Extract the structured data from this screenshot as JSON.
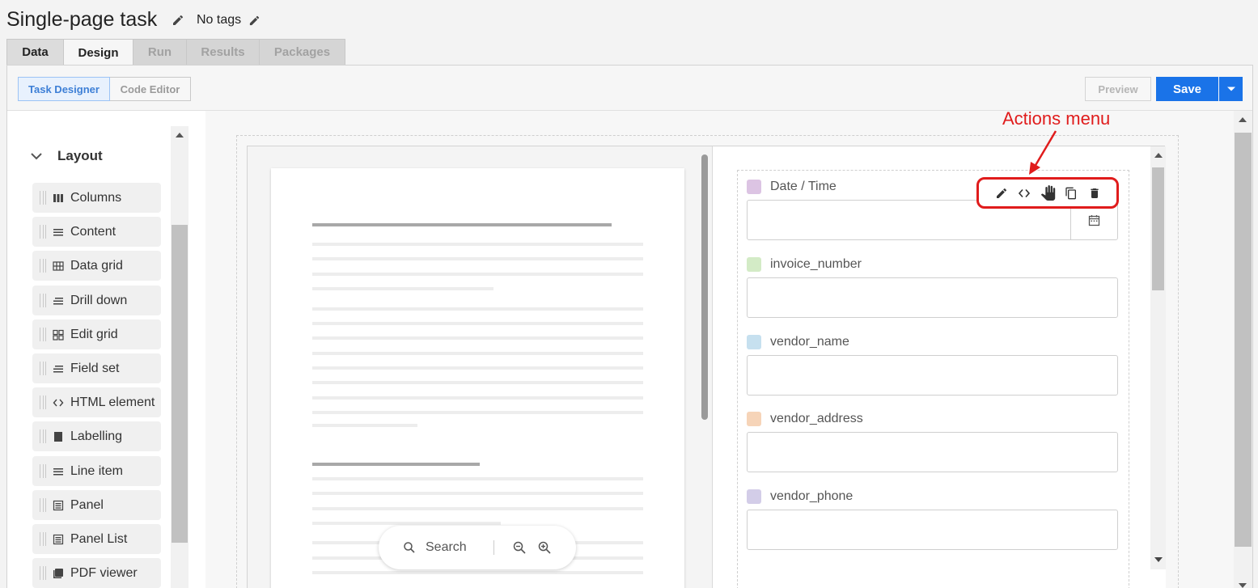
{
  "header": {
    "title": "Single-page task",
    "tags": "No tags"
  },
  "tabs": [
    {
      "label": "Data",
      "state": "normal"
    },
    {
      "label": "Design",
      "state": "active"
    },
    {
      "label": "Run",
      "state": "disabled"
    },
    {
      "label": "Results",
      "state": "disabled"
    },
    {
      "label": "Packages",
      "state": "disabled"
    }
  ],
  "toolbar": {
    "task_designer": "Task Designer",
    "code_editor": "Code Editor",
    "preview": "Preview",
    "save": "Save"
  },
  "sidebar": {
    "section": "Layout",
    "items": [
      {
        "label": "Columns",
        "icon": "columns-icon"
      },
      {
        "label": "Content",
        "icon": "content-icon"
      },
      {
        "label": "Data grid",
        "icon": "data-grid-icon"
      },
      {
        "label": "Drill down",
        "icon": "drill-down-icon"
      },
      {
        "label": "Edit grid",
        "icon": "edit-grid-icon"
      },
      {
        "label": "Field set",
        "icon": "field-set-icon"
      },
      {
        "label": "HTML element",
        "icon": "html-element-icon"
      },
      {
        "label": "Labelling",
        "icon": "labelling-icon"
      },
      {
        "label": "Line item",
        "icon": "line-item-icon"
      },
      {
        "label": "Panel",
        "icon": "panel-icon"
      },
      {
        "label": "Panel List",
        "icon": "panel-list-icon"
      },
      {
        "label": "PDF viewer",
        "icon": "pdf-viewer-icon"
      }
    ]
  },
  "document_viewer": {
    "search_label": "Search"
  },
  "form": {
    "fields": [
      {
        "label": "Date / Time",
        "color": "#dcc4e3",
        "type": "datetime"
      },
      {
        "label": "invoice_number",
        "color": "#d3ebc6",
        "type": "text"
      },
      {
        "label": "vendor_name",
        "color": "#c6e0ef",
        "type": "text"
      },
      {
        "label": "vendor_address",
        "color": "#f6d4b8",
        "type": "text"
      },
      {
        "label": "vendor_phone",
        "color": "#d3cde8",
        "type": "text"
      }
    ],
    "actions": [
      "edit-icon",
      "code-icon",
      "drag-hand-icon",
      "copy-icon",
      "delete-icon"
    ]
  },
  "annotation": {
    "label": "Actions menu",
    "color": "#e01c1c"
  },
  "colors": {
    "accent": "#1a73e8",
    "annotation": "#e01c1c"
  }
}
